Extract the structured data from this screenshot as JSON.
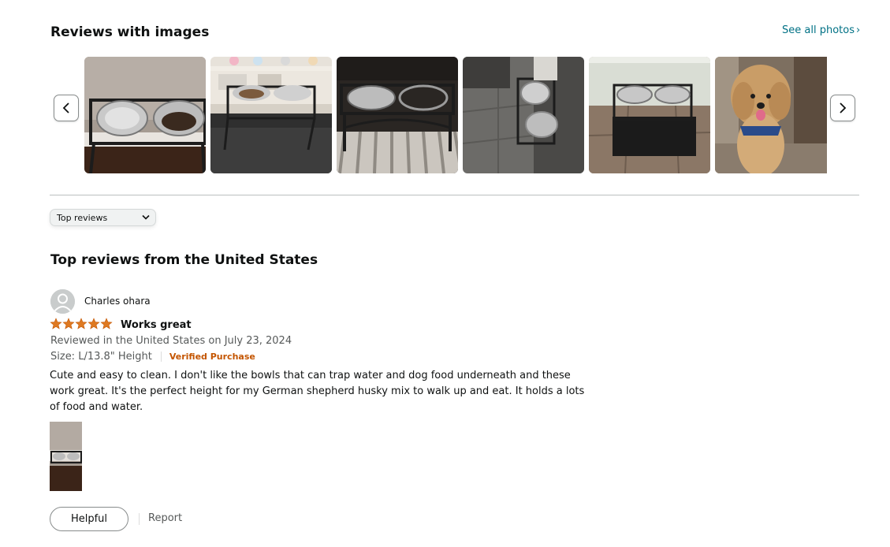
{
  "section": {
    "title": "Reviews with images",
    "see_all": "See all photos",
    "see_all_chevron": "›"
  },
  "carousel": {
    "prev_icon": "chevron-left-icon",
    "next_icon": "chevron-right-icon",
    "images": [
      {
        "subject": "two steel bowls in black raised stand on counter"
      },
      {
        "subject": "raised stand with food bowls on dark rug by shelves"
      },
      {
        "subject": "black metal bowl stand on striped rug"
      },
      {
        "subject": "tall stand with stacked bowls on tile floor"
      },
      {
        "subject": "bowl stand on black mat on tile floor"
      },
      {
        "subject": "doodle dog with blue bandana"
      }
    ]
  },
  "sort": {
    "selected": "Top reviews"
  },
  "reviews_heading": "Top reviews from the United States",
  "review": {
    "reviewer": "Charles ohara",
    "rating": 5,
    "title": "Works great",
    "date_line": "Reviewed in the United States on July 23, 2024",
    "size": "Size: L/13.8\" Height",
    "verified": "Verified Purchase",
    "body": "Cute and easy to clean. I don't like the bowls that can trap water and dog food underneath and these work great. It's the perfect height for my German shepherd husky mix to walk up and eat. It holds a lots of food and water.",
    "helpful_label": "Helpful",
    "report_label": "Report"
  },
  "colors": {
    "link": "#007185",
    "star": "#de7921",
    "verified": "#c45500",
    "muted_text": "#565959",
    "text": "#0f1111"
  }
}
